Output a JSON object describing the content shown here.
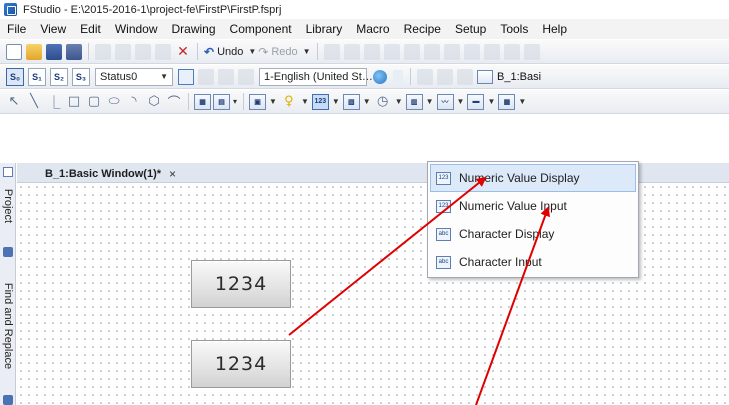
{
  "window": {
    "title": "FStudio - E:\\2015-2016-1\\project-fe\\FirstP\\FirstP.fsprj"
  },
  "menubar": [
    "File",
    "View",
    "Edit",
    "Window",
    "Drawing",
    "Component",
    "Library",
    "Macro",
    "Recipe",
    "Setup",
    "Tools",
    "Help"
  ],
  "toolbar1": {
    "undo_label": "Undo",
    "redo_label": "Redo"
  },
  "toolbar2": {
    "state_buttons": [
      "S₀",
      "S₁",
      "S₂",
      "S₃"
    ],
    "status_combo": "Status0",
    "language_combo": "1-English (United St…",
    "window_label": "B_1:Basi"
  },
  "side_panel": {
    "tabs": [
      "Project",
      "Find and Replace"
    ]
  },
  "doc_tab": {
    "label": "B_1:Basic Window(1)*",
    "close": "×"
  },
  "canvas": {
    "widgets": [
      "1234",
      "1234"
    ]
  },
  "dropdown": {
    "items": [
      {
        "icon": "123",
        "label": "Numeric Value Display"
      },
      {
        "icon": "123",
        "label": "Numeric Value Input"
      },
      {
        "icon": "abc",
        "label": "Character Display"
      },
      {
        "icon": "abc",
        "label": "Character Input"
      }
    ]
  },
  "colors": {
    "annotation_arrow": "#e00000",
    "menu_highlight": "#dce9f8",
    "canvas_dot": "#9ca3ad"
  }
}
